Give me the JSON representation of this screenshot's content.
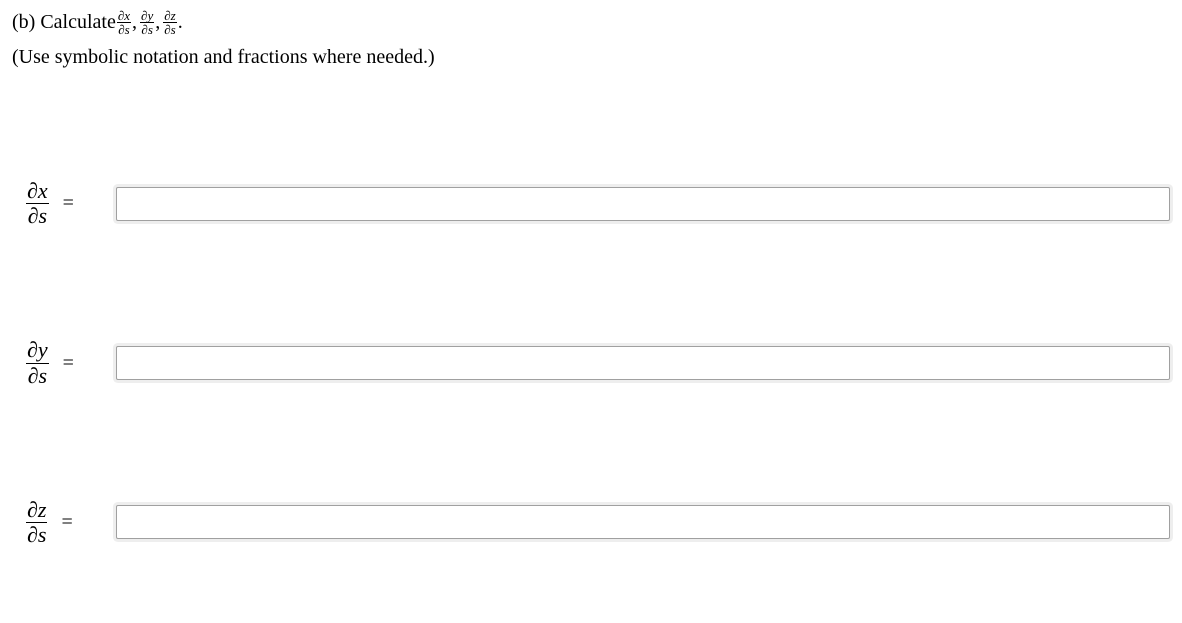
{
  "prompt": {
    "prefix": "(b) Calculate ",
    "terms": [
      {
        "num": "∂x",
        "den": "∂s"
      },
      {
        "num": "∂y",
        "den": "∂s"
      },
      {
        "num": "∂z",
        "den": "∂s"
      }
    ],
    "separator": ",",
    "terminator": "."
  },
  "instruction": "(Use symbolic notation and fractions where needed.)",
  "answers": [
    {
      "label_num": "∂x",
      "label_den": "∂s",
      "equals": "=",
      "value": ""
    },
    {
      "label_num": "∂y",
      "label_den": "∂s",
      "equals": "=",
      "value": ""
    },
    {
      "label_num": "∂z",
      "label_den": "∂s",
      "equals": "=",
      "value": ""
    }
  ]
}
